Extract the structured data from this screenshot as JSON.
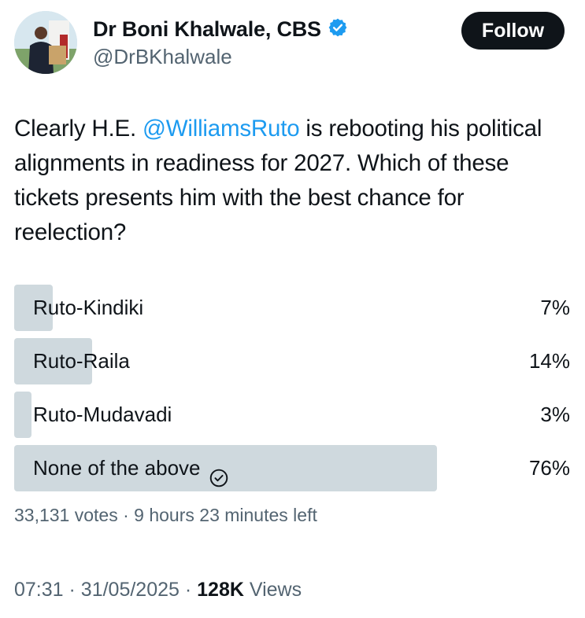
{
  "author": {
    "display_name": "Dr Boni Khalwale, CBS",
    "handle": "@DrBKhalwale",
    "verified_icon": "verified-badge-icon",
    "verified_color": "#1d9bf0"
  },
  "follow_label": "Follow",
  "tweet": {
    "text_before": "Clearly H.E. ",
    "mention": "@WilliamsRuto",
    "text_after": " is rebooting his political alignments in readiness for 2027. Which of these tickets presents him with the best chance for reelection?"
  },
  "poll": {
    "options": [
      {
        "label": "Ruto-Kindiki",
        "percent_text": "7%",
        "fraction": 0.07
      },
      {
        "label": "Ruto-Raila",
        "percent_text": "14%",
        "fraction": 0.14
      },
      {
        "label": "Ruto-Mudavadi",
        "percent_text": "3%",
        "fraction": 0.03
      },
      {
        "label": "None of the above",
        "percent_text": "76%",
        "fraction": 0.76,
        "selected_icon": "check-circle-icon"
      }
    ],
    "votes": "33,131 votes",
    "separator": "·",
    "time_left": "9 hours 23 minutes left"
  },
  "footer": {
    "time": "07:31",
    "date": "31/05/2025",
    "views_count": "128K",
    "views_label": "Views",
    "separator": "·"
  },
  "colors": {
    "bar": "#cfd9de",
    "link": "#1d9bf0",
    "muted": "#536471"
  }
}
